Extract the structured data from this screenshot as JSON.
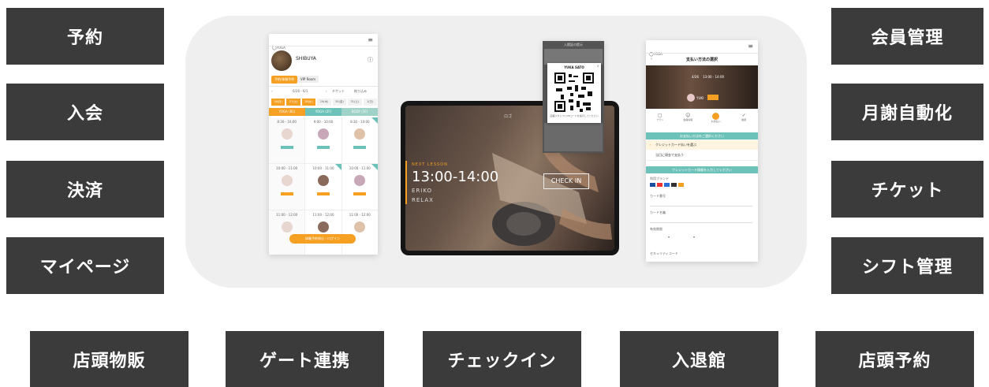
{
  "left_features": [
    "予約",
    "入会",
    "決済",
    "マイページ"
  ],
  "right_features": [
    "会員管理",
    "月謝自動化",
    "チケット",
    "シフト管理"
  ],
  "bottom_features": [
    "店頭物販",
    "ゲート連携",
    "チェックイン",
    "入退館",
    "店頭予約"
  ],
  "phone_left": {
    "logo": "YOGA",
    "studio_name": "SHIBUYA",
    "tab_active": "予約/体験予約",
    "tab_other": "VIP Room",
    "date_range": "6/26 - 6/1",
    "ticket_label": "チケット",
    "filter_label": "絞り込み",
    "day_labels": [
      "26(月)",
      "27(火)",
      "28(水)",
      "29(木)",
      "30(金)",
      "31(土)",
      "1(日)"
    ],
    "section_labels": [
      "YOGA (B1)",
      "YOGA (2F)",
      "BODY (3F)"
    ],
    "slots": [
      [
        "8:30 - 10:00",
        "9:00 - 10:00",
        "8:30 - 10:00"
      ],
      [
        "10:00 - 11:00",
        "10:00 - 11:00",
        "10:00 - 11:00"
      ],
      [
        "11:00 - 12:00",
        "11:00 - 12:00",
        "11:00 - 12:00"
      ]
    ],
    "bottom_button": "体験予約申込・ログイン"
  },
  "tablet": {
    "logo": "ロゴ",
    "next_lesson": "NEXT LESSON",
    "time": "13:00-14:00",
    "instructor": "ERIKO",
    "class_name": "RELAX",
    "checkin_button": "CHECK IN"
  },
  "qr_card": {
    "header": "入館証の提示",
    "title": "YUKA SATO",
    "footer": "店舗スタッフにQRコードを提示してください"
  },
  "phone_right": {
    "logo": "YOGA",
    "page_title": "支払い方法の選択",
    "lesson_date": "4/26",
    "lesson_time": "13:00 - 14:00",
    "instructor": "YUKI",
    "steps": [
      "プラン",
      "会員情報",
      "お支払い",
      "確認"
    ],
    "section1": "お支払い方法をご選択ください",
    "option_selected": "クレジットカード払いを選ぶ",
    "option_other": "当日に現金で支払う",
    "section2": "クレジットカード情報を入力してください",
    "field_labels": [
      "利用ブランド",
      "カード番号",
      "カード名義",
      "有効期限",
      "セキュリティコード"
    ]
  }
}
